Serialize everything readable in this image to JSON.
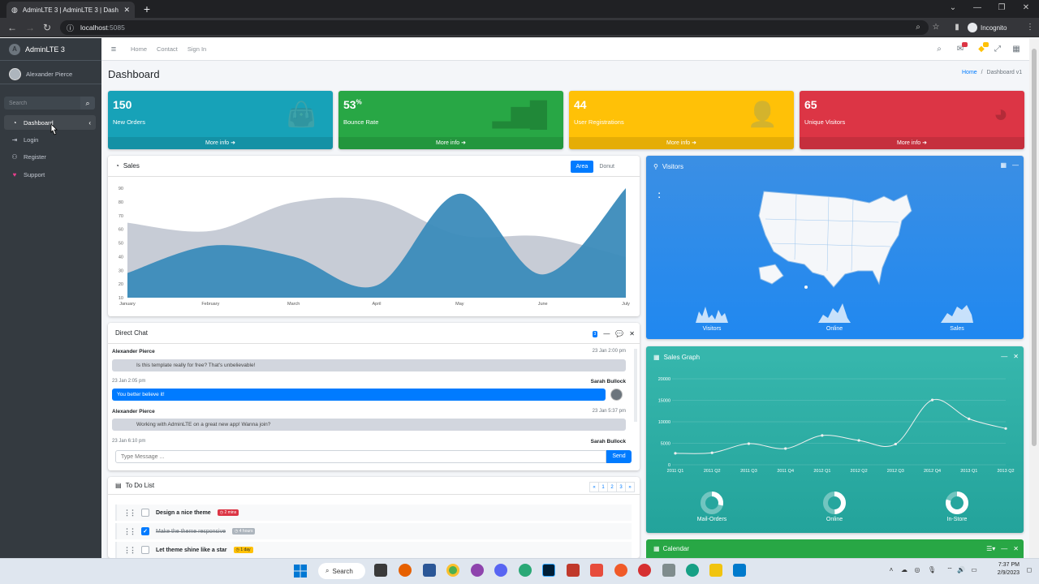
{
  "browser": {
    "tab_title": "AdminLTE 3 | AdminLTE 3 | Dash",
    "url_host": "localhost",
    "url_port": ":5085",
    "incognito_label": "Incognito"
  },
  "sidebar": {
    "brand": "AdminLTE 3",
    "user": "Alexander Pierce",
    "search_placeholder": "Search",
    "items": [
      {
        "label": "Dashboard",
        "icon": "dashboard-icon"
      },
      {
        "label": "Login",
        "icon": "sign-in-icon"
      },
      {
        "label": "Register",
        "icon": "user-plus-icon"
      },
      {
        "label": "Support",
        "icon": "heart-icon"
      }
    ]
  },
  "navbar": {
    "links": [
      "Home",
      "Contact",
      "Sign In"
    ],
    "messages_badge": "",
    "notifications_badge": ""
  },
  "header": {
    "title": "Dashboard",
    "breadcrumb_home": "Home",
    "breadcrumb_sep": "/",
    "breadcrumb_current": "Dashboard v1"
  },
  "small_boxes": [
    {
      "value": "150",
      "suffix": "",
      "label": "New Orders",
      "more": "More info",
      "color": "#17a2b8",
      "icon": "shopping-bag-icon"
    },
    {
      "value": "53",
      "suffix": "%",
      "label": "Bounce Rate",
      "more": "More info",
      "color": "#28a745",
      "icon": "bar-chart-icon"
    },
    {
      "value": "44",
      "suffix": "",
      "label": "User Registrations",
      "more": "More info",
      "color": "#ffc107",
      "icon": "user-add-icon"
    },
    {
      "value": "65",
      "suffix": "",
      "label": "Unique Visitors",
      "more": "More info",
      "color": "#dc3545",
      "icon": "pie-chart-icon"
    }
  ],
  "sales": {
    "title": "Sales",
    "tab_area": "Area",
    "tab_donut": "Donut"
  },
  "visitors": {
    "title": "Visitors",
    "labels": [
      "Visitors",
      "Online",
      "Sales"
    ]
  },
  "chat": {
    "title": "Direct Chat",
    "badge": "3",
    "messages": [
      {
        "name": "Alexander Pierce",
        "time": "23 Jan 2:00 pm",
        "text": "Is this template really for free? That's unbelievable!"
      },
      {
        "name": "Sarah Bullock",
        "time": "23 Jan 2:05 pm",
        "text": "You better believe it!"
      },
      {
        "name": "Alexander Pierce",
        "time": "23 Jan 5:37 pm",
        "text": "Working with AdminLTE on a great new app! Wanna join?"
      },
      {
        "name": "Sarah Bullock",
        "time": "23 Jan 6:10 pm",
        "text": ""
      }
    ],
    "input_placeholder": "Type Message ...",
    "send_label": "Send"
  },
  "todo": {
    "title": "To Do List",
    "pages": [
      "«",
      "1",
      "2",
      "3",
      "»"
    ],
    "items": [
      {
        "text": "Design a nice theme",
        "tag": "2 mins",
        "tag_color": "#dc3545",
        "checked": false
      },
      {
        "text": "Make the theme responsive",
        "tag": "4 hours",
        "tag_color": "#adb5bd",
        "checked": true
      },
      {
        "text": "Let theme shine like a star",
        "tag": "1 day",
        "tag_color": "#ffc107",
        "checked": false
      }
    ]
  },
  "sales_graph": {
    "title": "Sales Graph",
    "donut_labels": [
      "Mail-Orders",
      "Online",
      "In-Store"
    ]
  },
  "calendar": {
    "title": "Calendar"
  },
  "taskbar": {
    "search_label": "Search",
    "time": "7:37 PM",
    "date": "2/9/2023"
  },
  "chart_data": [
    {
      "type": "area",
      "title": "Sales",
      "categories": [
        "January",
        "February",
        "March",
        "April",
        "May",
        "June",
        "July"
      ],
      "ylim": [
        10,
        90
      ],
      "yticks": [
        10,
        20,
        30,
        40,
        50,
        60,
        70,
        80,
        90
      ],
      "series": [
        {
          "name": "",
          "color": "#c1c7d1",
          "values": [
            65,
            59,
            80,
            81,
            56,
            55,
            40
          ]
        },
        {
          "name": "",
          "color": "#3b8bba",
          "values": [
            28,
            48,
            40,
            19,
            86,
            27,
            90
          ]
        }
      ]
    },
    {
      "type": "line",
      "title": "Sales Graph",
      "categories": [
        "2011 Q1",
        "2011 Q2",
        "2011 Q3",
        "2011 Q4",
        "2012 Q1",
        "2012 Q2",
        "2012 Q3",
        "2012 Q4",
        "2013 Q1",
        "2013 Q2"
      ],
      "ylim": [
        0,
        20000
      ],
      "yticks": [
        0,
        5000,
        10000,
        15000,
        20000
      ],
      "series": [
        {
          "name": "",
          "color": "#efefef",
          "values": [
            2666,
            2778,
            4912,
            3767,
            6810,
            5670,
            4820,
            15073,
            10687,
            8432
          ]
        }
      ]
    }
  ]
}
